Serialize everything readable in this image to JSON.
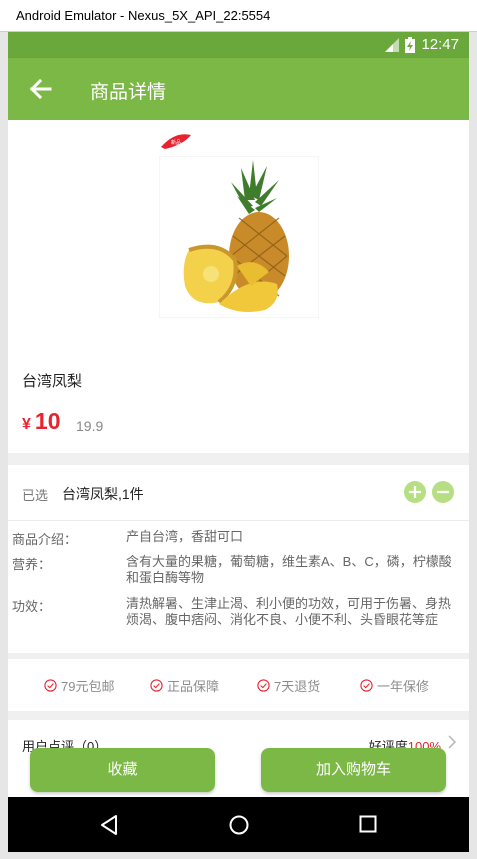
{
  "window": {
    "title": "Android Emulator - Nexus_5X_API_22:5554"
  },
  "status_bar": {
    "time": "12:47"
  },
  "app_bar": {
    "title": "商品详情"
  },
  "product": {
    "ribbon_text": "新品",
    "name": "台湾凤梨",
    "currency": "¥",
    "price": "10",
    "original_price": "19.9"
  },
  "selection": {
    "label": "已选",
    "value": "台湾凤梨,1件"
  },
  "info": [
    {
      "key": "商品介绍：",
      "value": "产自台湾，香甜可口"
    },
    {
      "key": "营养：",
      "value": "含有大量的果糖，葡萄糖，维生素A、B、C，磷，柠檬酸和蛋白酶等物"
    },
    {
      "key": "功效：",
      "value": "清热解暑、生津止渴、利小便的功效，可用于伤暑、身热烦渴、腹中痞闷、消化不良、小便不利、头昏眼花等症"
    }
  ],
  "services": [
    "79元包邮",
    "正品保障",
    "7天退货",
    "一年保修"
  ],
  "reviews": {
    "title": "用户点评（0）",
    "rating_label": "好评度",
    "rating_value": "100%"
  },
  "actions": {
    "favorite": "收藏",
    "add_to_cart": "加入购物车"
  },
  "colors": {
    "app_bar": "#7cb845",
    "status_bar": "#6aa83c",
    "price": "#e8232f",
    "qty_button": "#b6df84"
  }
}
